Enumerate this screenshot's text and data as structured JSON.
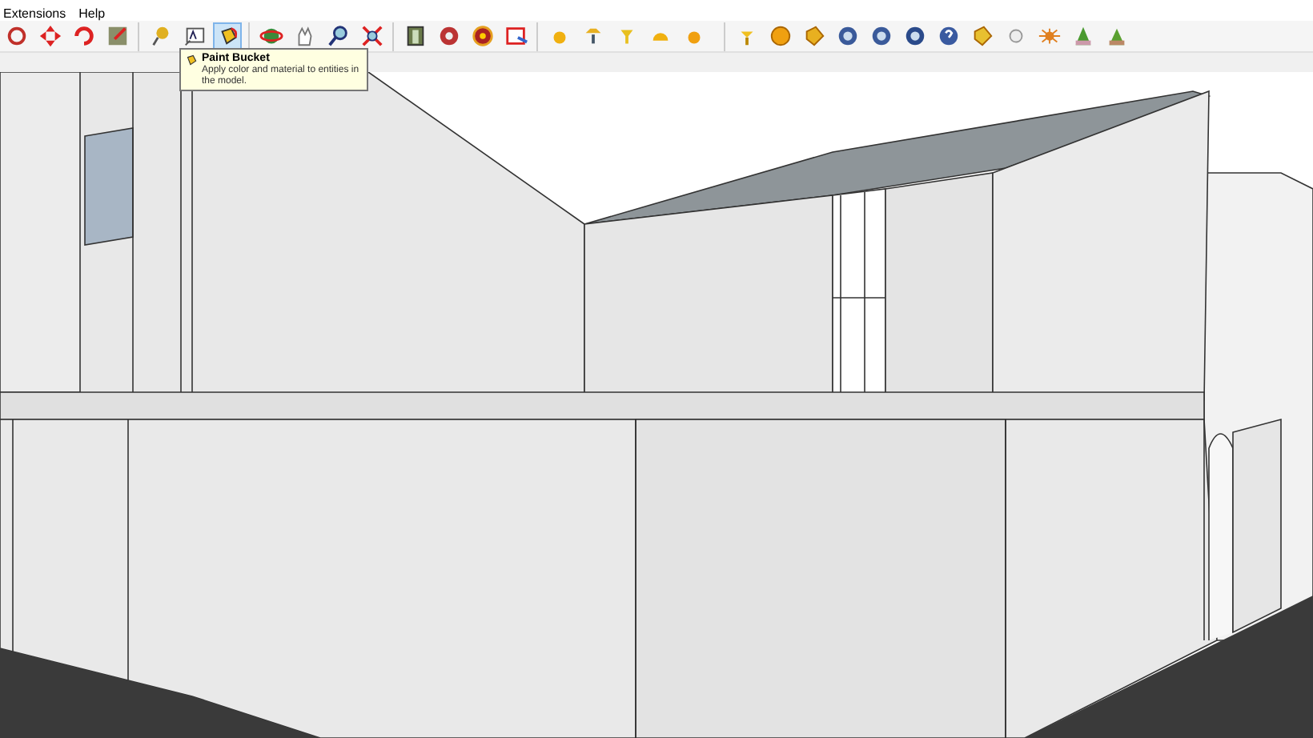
{
  "menu": [
    {
      "label": "Extensions"
    },
    {
      "label": "Help"
    }
  ],
  "toolbar": {
    "groups": [
      [
        {
          "selected": false
        },
        {
          "selected": false
        },
        {
          "selected": false
        },
        {
          "selected": false
        }
      ],
      [
        {
          "selected": false
        },
        {
          "selected": false
        },
        {
          "selected": true
        }
      ],
      [
        {
          "selected": false
        },
        {
          "selected": false
        },
        {
          "selected": false
        },
        {
          "selected": false
        }
      ],
      [
        {
          "selected": false
        },
        {
          "selected": false
        },
        {
          "selected": false
        },
        {
          "selected": false
        }
      ],
      [
        {
          "selected": false
        },
        {
          "selected": false
        },
        {
          "selected": false
        },
        {
          "selected": false
        },
        {
          "selected": false
        }
      ],
      [
        {
          "selected": false
        },
        {
          "selected": false
        },
        {
          "selected": false
        },
        {
          "selected": false
        },
        {
          "selected": false
        },
        {
          "selected": false
        },
        {
          "selected": false
        },
        {
          "selected": false
        },
        {
          "selected": false
        },
        {
          "selected": false
        },
        {
          "selected": false
        },
        {
          "selected": false
        }
      ]
    ]
  },
  "tooltip": {
    "title": "Paint Bucket",
    "text": "Apply color and material to entities in the model."
  }
}
